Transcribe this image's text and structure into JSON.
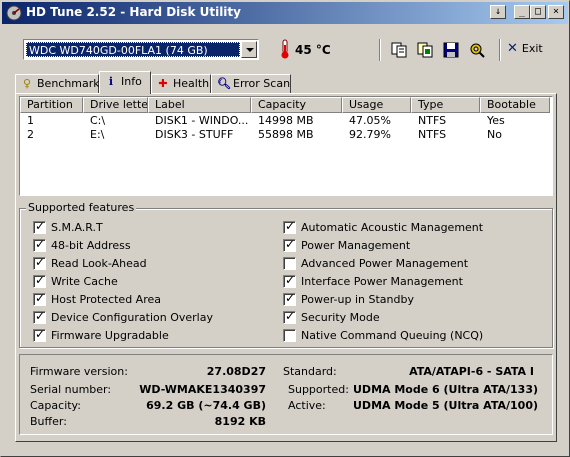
{
  "window": {
    "title": "HD Tune 2.52 - Hard Disk Utility",
    "buttons": {
      "down": "↓",
      "minimize": "_",
      "maximize": "□",
      "close": "×"
    }
  },
  "toolbar": {
    "drive": "WDC WD740GD-00FLA1 (74 GB)",
    "temperature": "45 °C",
    "exit_label": "Exit",
    "icons": [
      "copy-icon",
      "copy-info-icon",
      "save-icon",
      "options-icon"
    ]
  },
  "tabs": [
    {
      "label": "Benchmark",
      "icon": "benchmark-icon",
      "active": false
    },
    {
      "label": "Info",
      "icon": "info-icon",
      "active": true
    },
    {
      "label": "Health",
      "icon": "health-icon",
      "active": false
    },
    {
      "label": "Error Scan",
      "icon": "error-scan-icon",
      "active": false
    }
  ],
  "partitions": {
    "columns": [
      "Partition",
      "Drive letter",
      "Label",
      "Capacity",
      "Usage",
      "Type",
      "Bootable"
    ],
    "rows": [
      [
        "1",
        "C:\\",
        "DISK1 - WINDO...",
        "14998 MB",
        "47.05%",
        "NTFS",
        "Yes"
      ],
      [
        "2",
        "E:\\",
        "DISK3 - STUFF",
        "55898 MB",
        "92.79%",
        "NTFS",
        "No"
      ]
    ]
  },
  "features": {
    "label": "Supported features",
    "left": [
      {
        "label": "S.M.A.R.T",
        "checked": true
      },
      {
        "label": "48-bit Address",
        "checked": true
      },
      {
        "label": "Read Look-Ahead",
        "checked": true
      },
      {
        "label": "Write Cache",
        "checked": true
      },
      {
        "label": "Host Protected Area",
        "checked": true
      },
      {
        "label": "Device Configuration Overlay",
        "checked": true
      },
      {
        "label": "Firmware Upgradable",
        "checked": true
      }
    ],
    "right": [
      {
        "label": "Automatic Acoustic Management",
        "checked": true
      },
      {
        "label": "Power Management",
        "checked": true
      },
      {
        "label": "Advanced Power Management",
        "checked": false
      },
      {
        "label": "Interface Power Management",
        "checked": true
      },
      {
        "label": "Power-up in Standby",
        "checked": true
      },
      {
        "label": "Security Mode",
        "checked": true
      },
      {
        "label": "Native Command Queuing (NCQ)",
        "checked": false
      }
    ]
  },
  "info": {
    "firmware_label": "Firmware version:",
    "firmware": "27.08D27",
    "serial_label": "Serial number:",
    "serial": "WD-WMAKE1340397",
    "capacity_label": "Capacity:",
    "capacity": "69.2 GB (~74.4 GB)",
    "buffer_label": "Buffer:",
    "buffer": "8192 KB",
    "standard_label": "Standard:",
    "standard": "ATA/ATAPI-6 - SATA I",
    "supported_label": "Supported:",
    "supported": "UDMA Mode 6 (Ultra ATA/133)",
    "active_label": "Active:",
    "active": "UDMA Mode 5 (Ultra ATA/100)"
  }
}
